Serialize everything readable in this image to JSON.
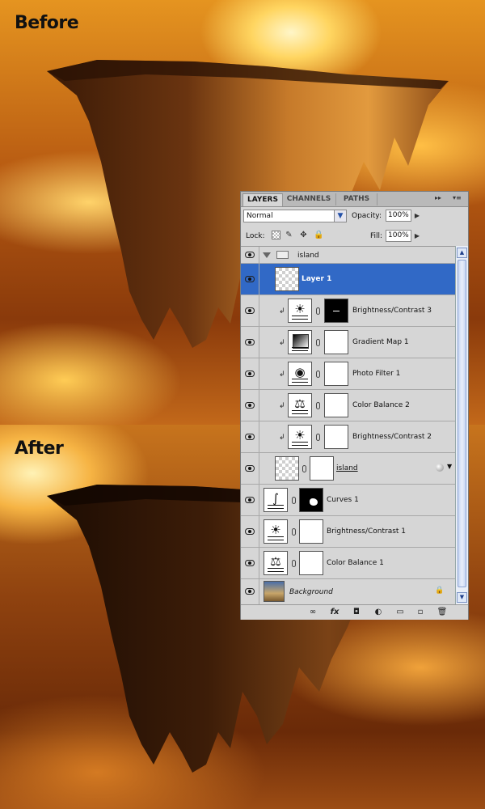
{
  "captions": {
    "before": "Before",
    "after": "After"
  },
  "panel": {
    "tabs": [
      "LAYERS",
      "CHANNELS",
      "PATHS"
    ],
    "active_tab": "LAYERS",
    "controls": {
      "collapse": "▸▸",
      "menu": "▾≡"
    },
    "blend_mode": "Normal",
    "opacity_label": "Opacity:",
    "opacity_value": "100%",
    "lock_label": "Lock:",
    "fill_label": "Fill:",
    "fill_value": "100%",
    "layers": [
      {
        "name": "island",
        "kind": "group"
      },
      {
        "name": "Layer 1",
        "kind": "pixel",
        "selected": true
      },
      {
        "name": "Brightness/Contrast 3",
        "kind": "brightness-contrast"
      },
      {
        "name": "Gradient Map 1",
        "kind": "gradient-map"
      },
      {
        "name": "Photo Filter 1",
        "kind": "photo-filter"
      },
      {
        "name": "Color Balance 2",
        "kind": "color-balance"
      },
      {
        "name": "Brightness/Contrast 2",
        "kind": "brightness-contrast"
      },
      {
        "name": "island",
        "kind": "smart-object"
      },
      {
        "name": "Curves 1",
        "kind": "curves"
      },
      {
        "name": "Brightness/Contrast 1",
        "kind": "brightness-contrast"
      },
      {
        "name": "Color Balance 1",
        "kind": "color-balance"
      },
      {
        "name": "Background",
        "kind": "background"
      }
    ],
    "bottom_buttons": {
      "link": "∞",
      "fx": "fx",
      "mask": "◘",
      "adjustment": "◐",
      "group": "▭",
      "new_layer": "▫",
      "delete": "🗑"
    }
  },
  "colors": {
    "selection": "#3169c6",
    "panel_bg": "#d6d6d6"
  }
}
